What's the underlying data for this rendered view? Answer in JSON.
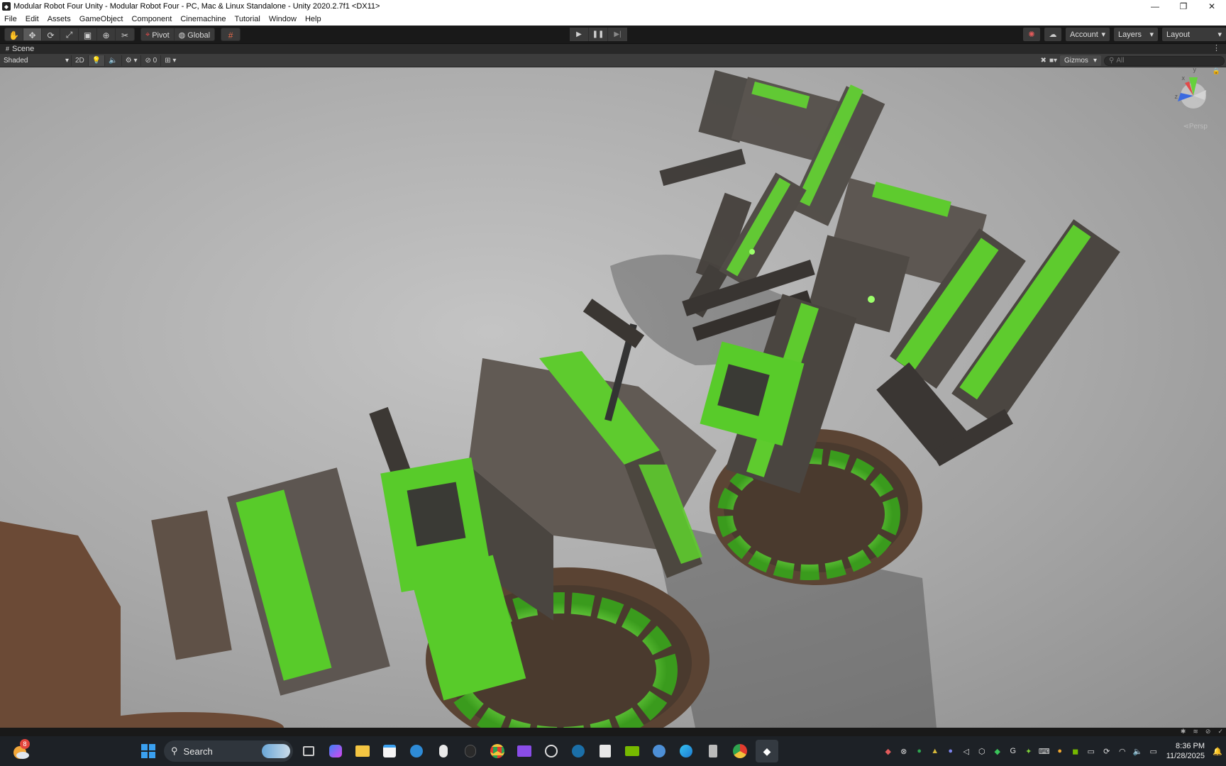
{
  "window": {
    "title": "Modular Robot Four Unity - Modular Robot Four - PC, Mac & Linux Standalone - Unity 2020.2.7f1 <DX11>",
    "controls": [
      "minimize-icon",
      "maximize-icon",
      "close-icon"
    ]
  },
  "menu": [
    "File",
    "Edit",
    "Assets",
    "GameObject",
    "Component",
    "Cinemachine",
    "Tutorial",
    "Window",
    "Help"
  ],
  "toolbar": {
    "tools": [
      "hand-tool-icon",
      "move-tool-icon",
      "rotate-tool-icon",
      "scale-tool-icon",
      "rect-tool-icon",
      "transform-tool-icon",
      "custom-tool-icon"
    ],
    "pivot_label": "Pivot",
    "global_label": "Global",
    "account_label": "Account",
    "layers_label": "Layers",
    "layout_label": "Layout"
  },
  "scene_tab": {
    "label": "Scene"
  },
  "scene_bar": {
    "draw_mode": "Shaded",
    "mode_2d": "2D",
    "hidden_count": "0",
    "gizmos_label": "Gizmos",
    "search_placeholder": "All"
  },
  "gizmo": {
    "axis_y": "y",
    "axis_x": "x",
    "axis_z": "z",
    "projection": "Persp"
  },
  "taskbar": {
    "search_label": "Search",
    "notification_count": "8",
    "time": "8:36 PM",
    "date": "11/28/2025"
  },
  "colors": {
    "accent_green": "#5ecb2e",
    "glow_green": "#9bff6a",
    "metal": "#5e5650",
    "rust": "#6b4a36",
    "floor": "#a8a8a8"
  }
}
